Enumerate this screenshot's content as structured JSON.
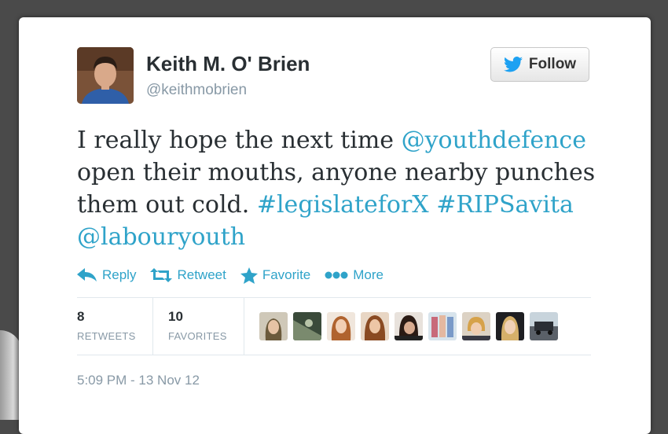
{
  "user": {
    "name": "Keith M. O' Brien",
    "handle": "@keithmobrien"
  },
  "follow_button": {
    "label": "Follow"
  },
  "tweet": {
    "line1_plain": "I really hope the next time ",
    "mention1": "@youthdefence",
    "line2_plain": "open their mouths, anyone nearby punches them out cold. ",
    "hashtag1": "#legislateforX",
    "hashtag2": "#RIPSavita",
    "mention2": "@labouryouth"
  },
  "actions": {
    "reply": "Reply",
    "retweet": "Retweet",
    "favorite": "Favorite",
    "more": "More"
  },
  "stats": {
    "retweets_count": "8",
    "retweets_label": "RETWEETS",
    "favorites_count": "10",
    "favorites_label": "FAVORITES"
  },
  "favoriter_avatars": [
    "avatar-1",
    "avatar-2",
    "avatar-3",
    "avatar-4",
    "avatar-5",
    "avatar-6",
    "avatar-7",
    "avatar-8",
    "avatar-9"
  ],
  "timestamp": "5:09 PM - 13 Nov 12",
  "colors": {
    "link": "#2fa3c9",
    "text": "#292f33",
    "muted": "#8899a6",
    "twitter_bird": "#1da1f2"
  }
}
